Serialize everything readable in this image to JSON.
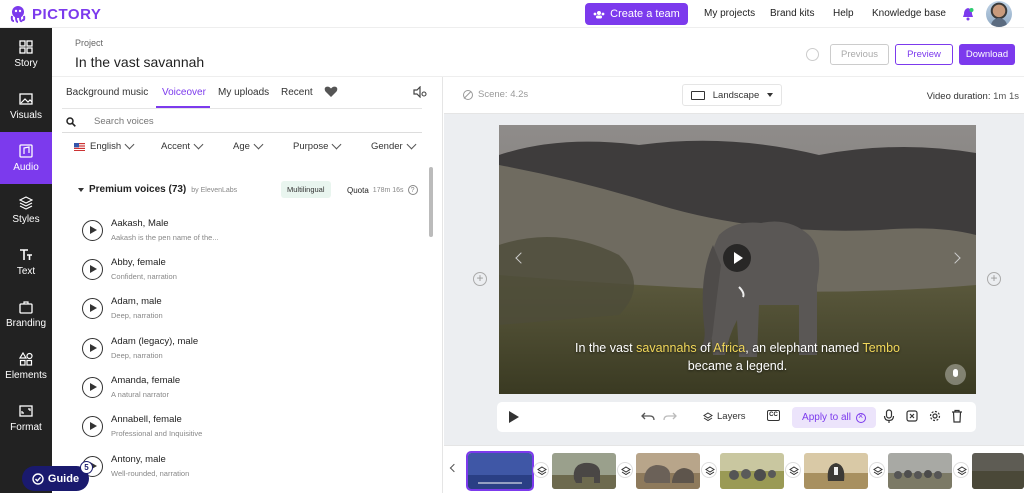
{
  "brand": {
    "name": "PICTORY",
    "accent": "#7c3aed"
  },
  "topbar": {
    "create_team": "Create a team",
    "nav": [
      "My projects",
      "Brand kits",
      "Help",
      "Knowledge base"
    ]
  },
  "leftnav": {
    "items": [
      {
        "label": "Story",
        "icon": "story-icon"
      },
      {
        "label": "Visuals",
        "icon": "visuals-icon"
      },
      {
        "label": "Audio",
        "icon": "audio-icon",
        "active": true
      },
      {
        "label": "Styles",
        "icon": "styles-icon"
      },
      {
        "label": "Text",
        "icon": "text-icon"
      },
      {
        "label": "Branding",
        "icon": "branding-icon"
      },
      {
        "label": "Elements",
        "icon": "elements-icon"
      },
      {
        "label": "Format",
        "icon": "format-icon"
      }
    ]
  },
  "project": {
    "label": "Project",
    "title": "In the vast savannah"
  },
  "actions": {
    "previous": "Previous",
    "preview": "Preview",
    "download": "Download"
  },
  "audio_panel": {
    "tabs": [
      "Background music",
      "Voiceover",
      "My uploads",
      "Recent"
    ],
    "active_tab": "Voiceover",
    "search_placeholder": "Search voices",
    "filters": [
      "English",
      "Accent",
      "Age",
      "Purpose",
      "Gender"
    ],
    "section": {
      "title": "Premium voices (73)",
      "by": "by ElevenLabs",
      "badge": "Multilingual",
      "quota_label": "Quota",
      "quota_value": "178m 16s"
    },
    "voices": [
      {
        "name": "Aakash, Male",
        "desc": "Aakash is the pen name of the..."
      },
      {
        "name": "Abby, female",
        "desc": "Confident, narration"
      },
      {
        "name": "Adam, male",
        "desc": "Deep, narration"
      },
      {
        "name": "Adam (legacy), male",
        "desc": "Deep, narration"
      },
      {
        "name": "Amanda, female",
        "desc": "A natural narrator"
      },
      {
        "name": "Annabell, female",
        "desc": "Professional and Inquisitive"
      },
      {
        "name": "Antony, male",
        "desc": "Well-rounded, narration"
      }
    ]
  },
  "guide": {
    "label": "Guide",
    "count": "5"
  },
  "stage": {
    "scene": "Scene: 4.2s",
    "orientation": "Landscape",
    "duration_label": "Video duration:",
    "duration_value": "1m 1s"
  },
  "caption": {
    "p1": "In the vast ",
    "h1": "savannahs",
    "p2": " of ",
    "h2": "Africa",
    "p3": ", an elephant named ",
    "h3": "Tembo",
    "line2": "became a legend."
  },
  "controls": {
    "layers": "Layers",
    "cc": "CC",
    "apply_all": "Apply to all"
  }
}
